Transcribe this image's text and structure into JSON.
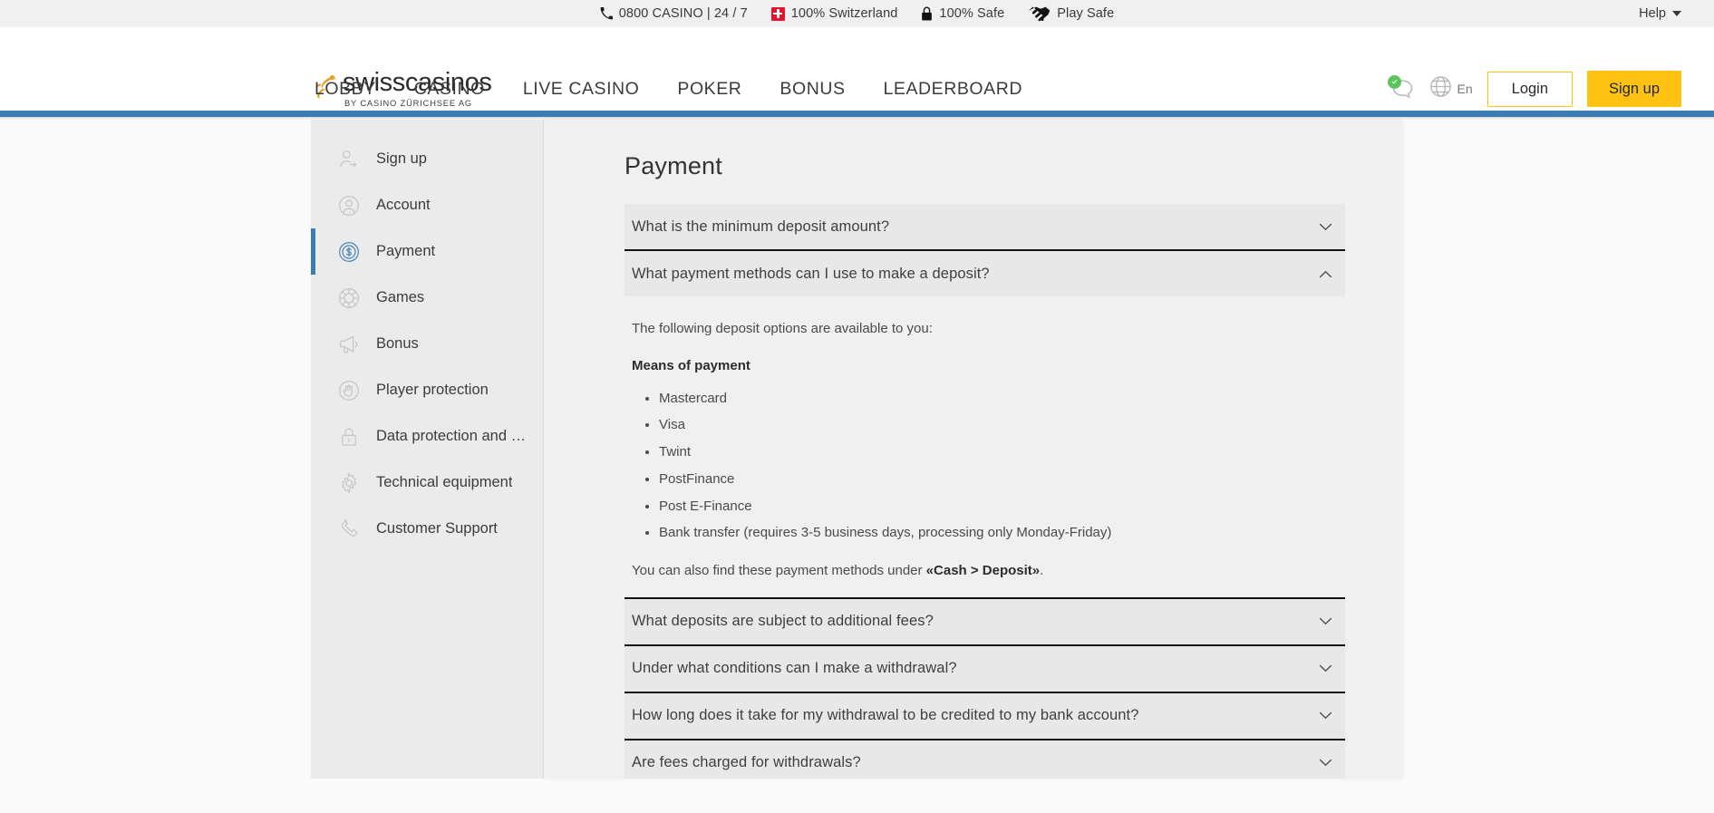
{
  "topbar": {
    "items": [
      {
        "icon": "phone-icon",
        "label": "0800 CASINO | 24 / 7"
      },
      {
        "icon": "swiss-flag-icon",
        "label": "100% Switzerland"
      },
      {
        "icon": "lock-icon",
        "label": "100% Safe"
      },
      {
        "icon": "handshake-icon",
        "label": "Play Safe"
      }
    ],
    "help_label": "Help"
  },
  "header": {
    "logo_main": "swisscasinos",
    "logo_sub": "BY CASINO ZÜRICHSEE AG",
    "language": "En",
    "login_label": "Login",
    "signup_label": "Sign up",
    "nav": [
      {
        "label": "LOBBY"
      },
      {
        "label": "CASINO"
      },
      {
        "label": "LIVE CASINO"
      },
      {
        "label": "POKER"
      },
      {
        "label": "BONUS"
      },
      {
        "label": "LEADERBOARD"
      }
    ]
  },
  "sidebar": {
    "items": [
      {
        "label": "Sign up",
        "icon": "user-add-icon",
        "active": false
      },
      {
        "label": "Account",
        "icon": "user-circle-icon",
        "active": false
      },
      {
        "label": "Payment",
        "icon": "coin-dollar-icon",
        "active": true
      },
      {
        "label": "Games",
        "icon": "poker-chip-icon",
        "active": false
      },
      {
        "label": "Bonus",
        "icon": "megaphone-icon",
        "active": false
      },
      {
        "label": "Player protection",
        "icon": "hand-stop-icon",
        "active": false
      },
      {
        "label": "Data protection and pri…",
        "icon": "padlock-icon",
        "active": false
      },
      {
        "label": "Technical equipment",
        "icon": "gear-icon",
        "active": false
      },
      {
        "label": "Customer Support",
        "icon": "phone-handset-icon",
        "active": false
      }
    ]
  },
  "main": {
    "title": "Payment",
    "faq": [
      {
        "question": "What is the minimum deposit amount?",
        "expanded": false
      },
      {
        "question": "What payment methods can I use to make a deposit?",
        "expanded": true,
        "lead": "The following deposit options are available to you:",
        "subhead": "Means of payment",
        "methods": [
          "Mastercard",
          "Visa",
          "Twint",
          "PostFinance",
          "Post E-Finance",
          "Bank transfer (requires 3-5 business days, processing only Monday-Friday)"
        ],
        "outro_before": "You can also find these payment methods under ",
        "outro_strong": "«Cash > Deposit»",
        "outro_after": "."
      },
      {
        "question": "What deposits are subject to additional fees?",
        "expanded": false
      },
      {
        "question": "Under what conditions can I make a withdrawal?",
        "expanded": false
      },
      {
        "question": "How long does it take for my withdrawal to be credited to my bank account?",
        "expanded": false
      },
      {
        "question": "Are fees charged for withdrawals?",
        "expanded": false
      }
    ]
  },
  "colors": {
    "accent_blue": "#3c7cb4",
    "brand_yellow": "#fdc212",
    "swiss_red": "#e8112d",
    "status_green": "#5cc45c",
    "logo_gold": "#e0a528"
  }
}
